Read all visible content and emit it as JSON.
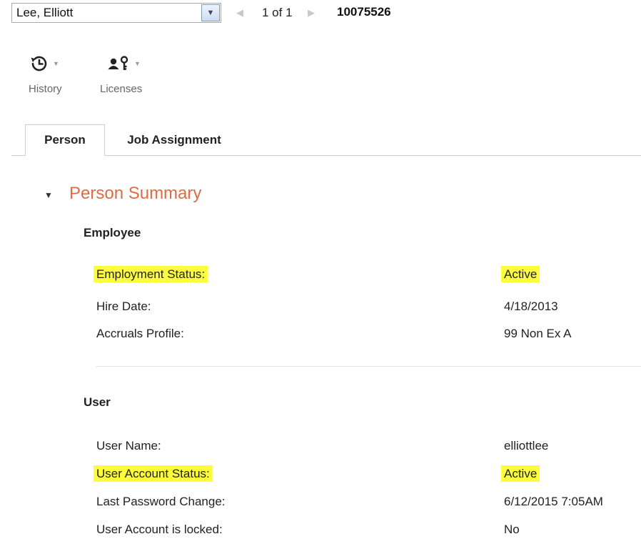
{
  "header": {
    "person_name": "Lee, Elliott",
    "pager": "1 of 1",
    "employee_id": "10075526"
  },
  "toolbar": {
    "history_label": "History",
    "licenses_label": "Licenses"
  },
  "tabs": [
    {
      "label": "Person",
      "active": true
    },
    {
      "label": "Job Assignment",
      "active": false
    }
  ],
  "section": {
    "title": "Person Summary",
    "groups": {
      "employee": {
        "title": "Employee",
        "rows": [
          {
            "label": "Employment Status:",
            "value": "Active"
          },
          {
            "label": "Hire Date:",
            "value": "4/18/2013"
          },
          {
            "label": "Accruals Profile:",
            "value": "99 Non Ex A"
          }
        ]
      },
      "user": {
        "title": "User",
        "rows": [
          {
            "label": "User Name:",
            "value": "elliottlee"
          },
          {
            "label": "User Account Status:",
            "value": "Active"
          },
          {
            "label": "Last Password Change:",
            "value": "6/12/2015 7:05AM"
          },
          {
            "label": "User Account is locked:",
            "value": "No"
          }
        ]
      }
    }
  },
  "colors": {
    "section_title": "#e06a45",
    "highlight": "#fdfd3c"
  },
  "icons": [
    "chevron-down-icon",
    "prev-arrow-icon",
    "next-arrow-icon",
    "history-icon",
    "licenses-icon",
    "caret-down-icon",
    "section-collapse-icon"
  ]
}
